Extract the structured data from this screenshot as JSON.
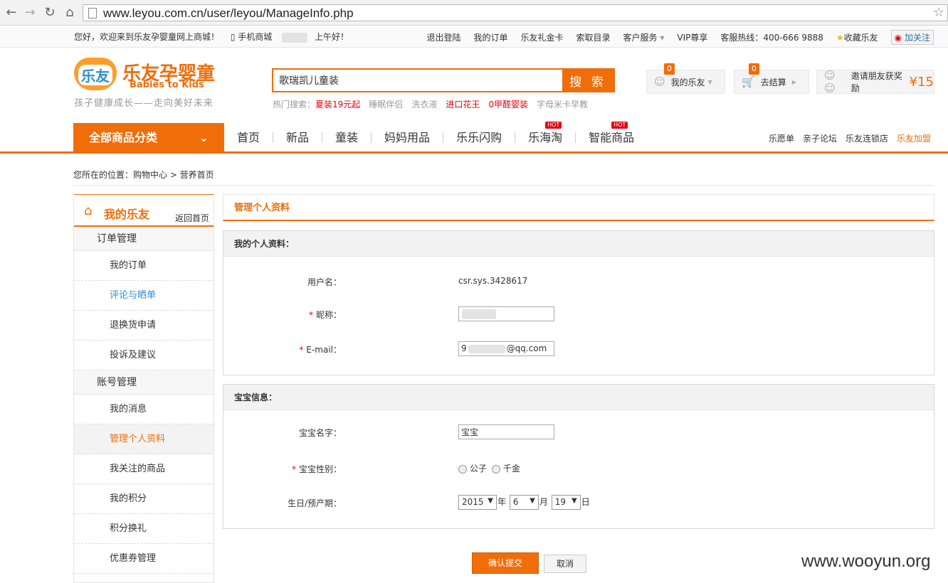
{
  "browser": {
    "url": "www.leyou.com.cn/user/leyou/ManageInfo.php"
  },
  "topbar": {
    "welcome": "您好，欢迎来到乐友孕婴童网上商城！",
    "mobile": "手机商城",
    "greeting": "上午好！",
    "links": [
      "退出登陆",
      "我的订单",
      "乐友礼金卡",
      "索取目录",
      "客户服务",
      "VIP尊享",
      "客服热线：400-666 9888",
      "收藏乐友"
    ],
    "follow": "加关注"
  },
  "header": {
    "logo_badge": "乐友",
    "logo_cn": "乐友孕婴童",
    "logo_en": "Babies to Kids",
    "slogan": "孩子健康成长——走向美好未来",
    "search_value": "歌瑞凯儿童装",
    "search_button": "搜 索",
    "hot_label": "热门搜索：",
    "hot_terms": [
      "夏装19元起",
      "睡眠伴侣",
      "洗衣液",
      "进口花王",
      "0甲醛婴装",
      "字母米卡早教"
    ],
    "my_leyou": "我的乐友",
    "my_leyou_count": "0",
    "cart": "去结算",
    "cart_count": "0",
    "invite": "邀请朋友获奖励",
    "invite_amount": "¥15"
  },
  "menu": {
    "all": "全部商品分类",
    "items": [
      "首页",
      "新品",
      "童装",
      "妈妈用品",
      "乐乐闪购",
      "乐海淘",
      "智能商品"
    ],
    "hot": "HOT",
    "right": [
      "乐愿单",
      "亲子论坛",
      "乐友连锁店",
      "乐友加盟"
    ]
  },
  "breadcrumb": "您所在的位置：购物中心 > 营养首页",
  "sidebar": {
    "title": "我的乐友",
    "back": "返回首页",
    "sections": [
      {
        "title": "订单管理",
        "items": [
          "我的订单",
          "评论与晒单",
          "退换货申请",
          "投诉及建议"
        ]
      },
      {
        "title": "账号管理",
        "items": [
          "我的消息",
          "管理个人资料",
          "我关注的商品",
          "我的积分",
          "积分换礼",
          "优惠券管理"
        ]
      }
    ]
  },
  "main": {
    "title": "管理个人资料",
    "profile": {
      "heading": "我的个人资料：",
      "username_label": "用户名：",
      "username": "csr.sys.3428617",
      "nickname_label": "昵称：",
      "nickname": "",
      "email_label": "E-mail：",
      "email_prefix": "9",
      "email_suffix": "@qq.com"
    },
    "baby": {
      "heading": "宝宝信息：",
      "name_label": "宝宝名字：",
      "name": "宝宝",
      "gender_label": "宝宝性别：",
      "gender_options": [
        "公子",
        "千金"
      ],
      "birth_label": "生日/预产期：",
      "year": "2015",
      "year_unit": "年",
      "month": "6",
      "month_unit": "月",
      "day": "19",
      "day_unit": "日"
    },
    "submit": "确认提交",
    "cancel": "取消"
  },
  "watermark": "www.wooyun.org"
}
